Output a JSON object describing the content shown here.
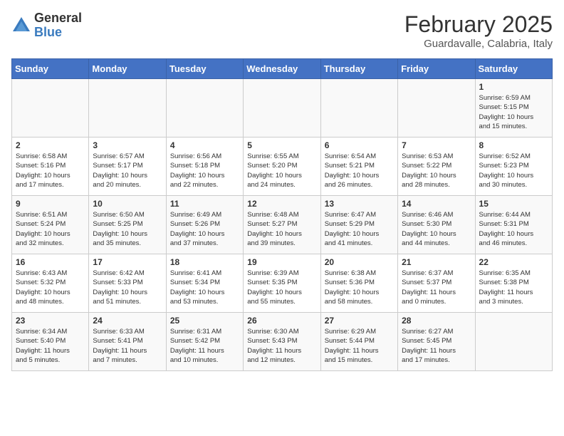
{
  "header": {
    "logo_general": "General",
    "logo_blue": "Blue",
    "title": "February 2025",
    "subtitle": "Guardavalle, Calabria, Italy"
  },
  "weekdays": [
    "Sunday",
    "Monday",
    "Tuesday",
    "Wednesday",
    "Thursday",
    "Friday",
    "Saturday"
  ],
  "weeks": [
    [
      {
        "day": "",
        "info": ""
      },
      {
        "day": "",
        "info": ""
      },
      {
        "day": "",
        "info": ""
      },
      {
        "day": "",
        "info": ""
      },
      {
        "day": "",
        "info": ""
      },
      {
        "day": "",
        "info": ""
      },
      {
        "day": "1",
        "info": "Sunrise: 6:59 AM\nSunset: 5:15 PM\nDaylight: 10 hours\nand 15 minutes."
      }
    ],
    [
      {
        "day": "2",
        "info": "Sunrise: 6:58 AM\nSunset: 5:16 PM\nDaylight: 10 hours\nand 17 minutes."
      },
      {
        "day": "3",
        "info": "Sunrise: 6:57 AM\nSunset: 5:17 PM\nDaylight: 10 hours\nand 20 minutes."
      },
      {
        "day": "4",
        "info": "Sunrise: 6:56 AM\nSunset: 5:18 PM\nDaylight: 10 hours\nand 22 minutes."
      },
      {
        "day": "5",
        "info": "Sunrise: 6:55 AM\nSunset: 5:20 PM\nDaylight: 10 hours\nand 24 minutes."
      },
      {
        "day": "6",
        "info": "Sunrise: 6:54 AM\nSunset: 5:21 PM\nDaylight: 10 hours\nand 26 minutes."
      },
      {
        "day": "7",
        "info": "Sunrise: 6:53 AM\nSunset: 5:22 PM\nDaylight: 10 hours\nand 28 minutes."
      },
      {
        "day": "8",
        "info": "Sunrise: 6:52 AM\nSunset: 5:23 PM\nDaylight: 10 hours\nand 30 minutes."
      }
    ],
    [
      {
        "day": "9",
        "info": "Sunrise: 6:51 AM\nSunset: 5:24 PM\nDaylight: 10 hours\nand 32 minutes."
      },
      {
        "day": "10",
        "info": "Sunrise: 6:50 AM\nSunset: 5:25 PM\nDaylight: 10 hours\nand 35 minutes."
      },
      {
        "day": "11",
        "info": "Sunrise: 6:49 AM\nSunset: 5:26 PM\nDaylight: 10 hours\nand 37 minutes."
      },
      {
        "day": "12",
        "info": "Sunrise: 6:48 AM\nSunset: 5:27 PM\nDaylight: 10 hours\nand 39 minutes."
      },
      {
        "day": "13",
        "info": "Sunrise: 6:47 AM\nSunset: 5:29 PM\nDaylight: 10 hours\nand 41 minutes."
      },
      {
        "day": "14",
        "info": "Sunrise: 6:46 AM\nSunset: 5:30 PM\nDaylight: 10 hours\nand 44 minutes."
      },
      {
        "day": "15",
        "info": "Sunrise: 6:44 AM\nSunset: 5:31 PM\nDaylight: 10 hours\nand 46 minutes."
      }
    ],
    [
      {
        "day": "16",
        "info": "Sunrise: 6:43 AM\nSunset: 5:32 PM\nDaylight: 10 hours\nand 48 minutes."
      },
      {
        "day": "17",
        "info": "Sunrise: 6:42 AM\nSunset: 5:33 PM\nDaylight: 10 hours\nand 51 minutes."
      },
      {
        "day": "18",
        "info": "Sunrise: 6:41 AM\nSunset: 5:34 PM\nDaylight: 10 hours\nand 53 minutes."
      },
      {
        "day": "19",
        "info": "Sunrise: 6:39 AM\nSunset: 5:35 PM\nDaylight: 10 hours\nand 55 minutes."
      },
      {
        "day": "20",
        "info": "Sunrise: 6:38 AM\nSunset: 5:36 PM\nDaylight: 10 hours\nand 58 minutes."
      },
      {
        "day": "21",
        "info": "Sunrise: 6:37 AM\nSunset: 5:37 PM\nDaylight: 11 hours\nand 0 minutes."
      },
      {
        "day": "22",
        "info": "Sunrise: 6:35 AM\nSunset: 5:38 PM\nDaylight: 11 hours\nand 3 minutes."
      }
    ],
    [
      {
        "day": "23",
        "info": "Sunrise: 6:34 AM\nSunset: 5:40 PM\nDaylight: 11 hours\nand 5 minutes."
      },
      {
        "day": "24",
        "info": "Sunrise: 6:33 AM\nSunset: 5:41 PM\nDaylight: 11 hours\nand 7 minutes."
      },
      {
        "day": "25",
        "info": "Sunrise: 6:31 AM\nSunset: 5:42 PM\nDaylight: 11 hours\nand 10 minutes."
      },
      {
        "day": "26",
        "info": "Sunrise: 6:30 AM\nSunset: 5:43 PM\nDaylight: 11 hours\nand 12 minutes."
      },
      {
        "day": "27",
        "info": "Sunrise: 6:29 AM\nSunset: 5:44 PM\nDaylight: 11 hours\nand 15 minutes."
      },
      {
        "day": "28",
        "info": "Sunrise: 6:27 AM\nSunset: 5:45 PM\nDaylight: 11 hours\nand 17 minutes."
      },
      {
        "day": "",
        "info": ""
      }
    ]
  ]
}
